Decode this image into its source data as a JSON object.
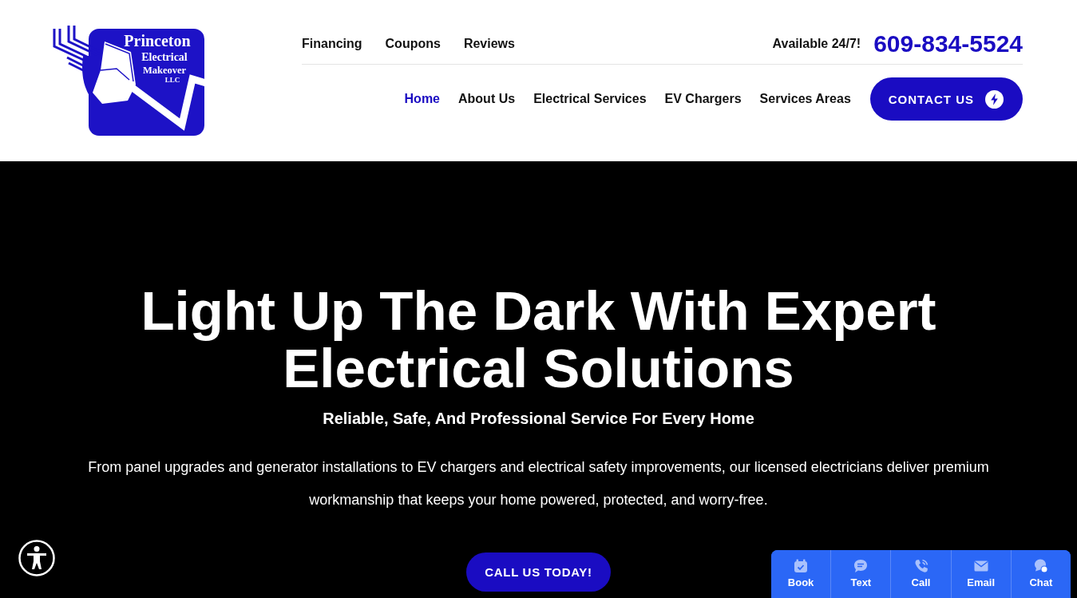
{
  "header": {
    "logo": {
      "name_lines": [
        "Princeton",
        "Electrical",
        "Makeover",
        "LLC"
      ]
    },
    "utility_links": [
      "Financing",
      "Coupons",
      "Reviews"
    ],
    "availability": "Available 24/7!",
    "phone": "609-834-5524",
    "nav": [
      {
        "label": "Home",
        "selected": true
      },
      {
        "label": "About Us",
        "selected": false
      },
      {
        "label": "Electrical Services",
        "selected": false
      },
      {
        "label": "EV Chargers",
        "selected": false
      },
      {
        "label": "Services Areas",
        "selected": false
      }
    ],
    "contact_button": "CONTACT US"
  },
  "hero": {
    "heading": "Light Up The Dark With Expert Electrical Solutions",
    "subheading": "Reliable, Safe, And Professional Service For Every Home",
    "body": "From panel upgrades and generator installations to EV chargers and electrical safety improvements, our licensed electricians deliver premium workmanship that keeps your home powered, protected, and worry-free.",
    "button": "CALL US TODAY!"
  },
  "action_bar": [
    {
      "label": "Book",
      "kind": "calendar"
    },
    {
      "label": "Text",
      "kind": "message"
    },
    {
      "label": "Call",
      "kind": "phone"
    },
    {
      "label": "Email",
      "kind": "mail"
    },
    {
      "label": "Chat",
      "kind": "chat"
    }
  ]
}
